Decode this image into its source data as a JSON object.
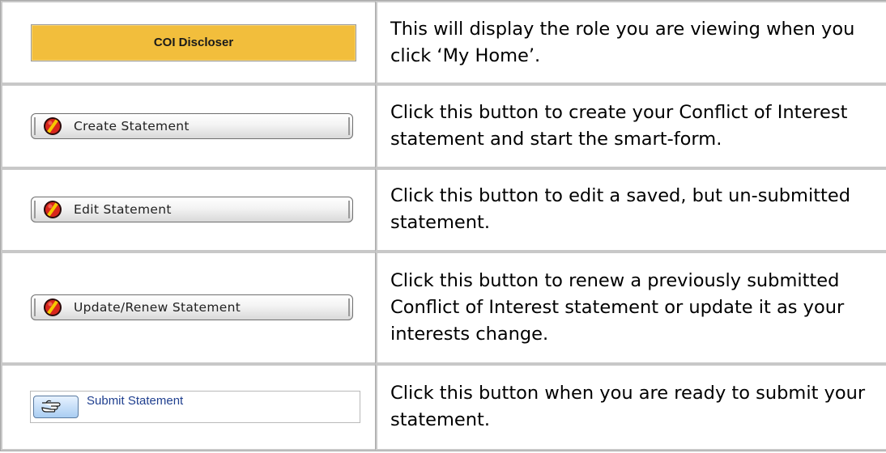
{
  "colors": {
    "role_banner_bg": "#f2be3c",
    "button_border": "#6e6e6e",
    "link_text": "#1f3f8f",
    "submit_icon_bg": "#a9cdf2"
  },
  "rows": [
    {
      "control": {
        "type": "role-banner",
        "label": "COI Discloser"
      },
      "description": "This will display the role you are viewing when you click ‘My Home’."
    },
    {
      "control": {
        "type": "statement-button",
        "label": "Create Statement",
        "icon": "no-entry-icon"
      },
      "description": "Click this button to create your Conflict of Interest statement and start the smart-form."
    },
    {
      "control": {
        "type": "statement-button",
        "label": "Edit Statement",
        "icon": "no-entry-icon"
      },
      "description": "Click this button to edit a saved, but un-submitted statement."
    },
    {
      "control": {
        "type": "statement-button",
        "label": "Update/Renew Statement",
        "icon": "no-entry-icon"
      },
      "description": "Click this button to renew a previously submitted Conflict of Interest statement or update it as your interests change."
    },
    {
      "control": {
        "type": "submit-button",
        "label": "Submit Statement",
        "icon": "pointing-hand-icon"
      },
      "description": "Click this button when you are ready to submit your statement."
    }
  ]
}
